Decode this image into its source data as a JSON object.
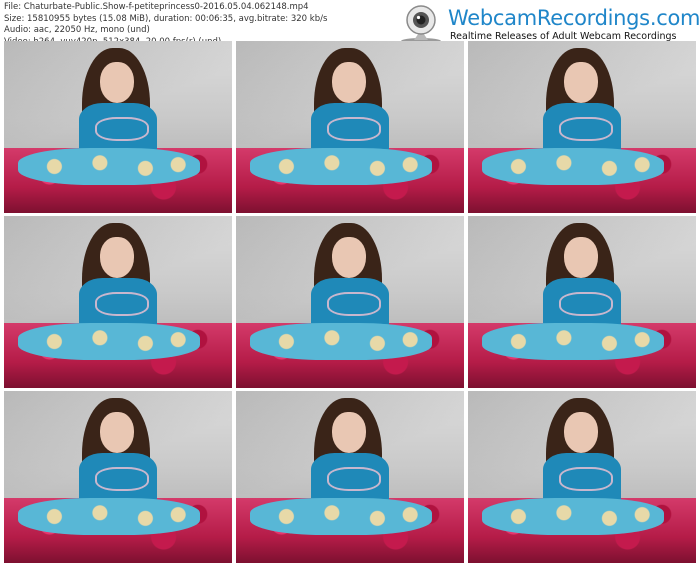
{
  "file_info": {
    "line1": "File: Chaturbate-Public.Show-f-petiteprincess0-2016.05.04.062148.mp4",
    "line2": "Size: 15810955 bytes (15.08 MiB), duration: 00:06:35, avg.bitrate: 320 kb/s",
    "line3": "Audio: aac, 22050 Hz, mono (und)",
    "line4": "Video: h264, yuv420p, 512x384, 20.00 fps(r) (und)"
  },
  "logo": {
    "title": "WebcamRecordings.com",
    "subtitle": "Realtime Releases of Adult Webcam Recordings",
    "icon": "webcam-icon",
    "color": "#1f86c9"
  },
  "thumbnails": [
    {
      "id": 1
    },
    {
      "id": 2
    },
    {
      "id": 3
    },
    {
      "id": 4
    },
    {
      "id": 5
    },
    {
      "id": 6
    },
    {
      "id": 7
    },
    {
      "id": 8
    },
    {
      "id": 9
    }
  ]
}
